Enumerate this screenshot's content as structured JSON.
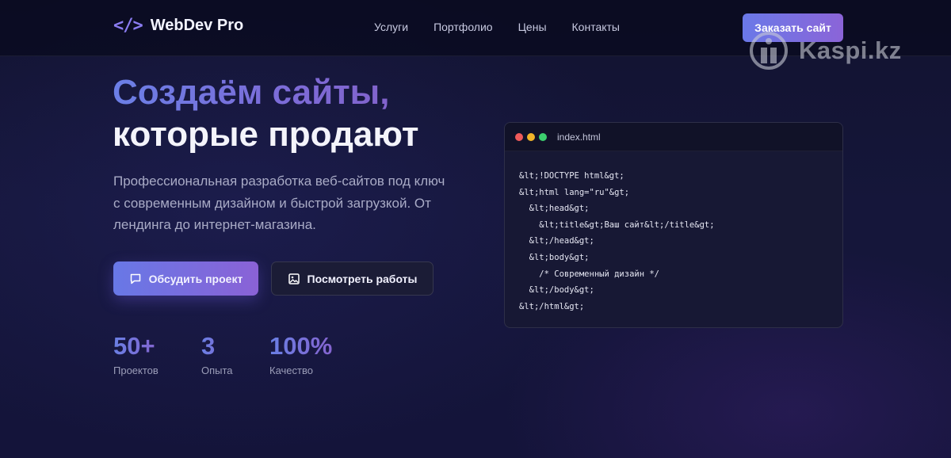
{
  "brand": {
    "logo_symbol": "</>",
    "name": "WebDev Pro"
  },
  "nav": {
    "items": [
      "Услуги",
      "Портфолио",
      "Цены",
      "Контакты"
    ]
  },
  "header": {
    "cta_label": "Заказать сайт"
  },
  "watermark": {
    "text": "Kaspi.kz"
  },
  "hero": {
    "title_line1": "Создаём сайты,",
    "title_line2": "которые продают",
    "description": "Профессиональная разработка веб-сайтов под ключ с современным дизайном и быстрой загрузкой. От лендинга до интернет-магазина.",
    "primary_button": {
      "label": "Обсудить проект",
      "icon": "chat-bubble-icon"
    },
    "secondary_button": {
      "label": "Посмотреть работы",
      "icon": "image-icon"
    }
  },
  "stats": [
    {
      "value": "50+",
      "label": "Проектов"
    },
    {
      "value": "3",
      "label": "Опыта"
    },
    {
      "value": "100%",
      "label": "Качество"
    }
  ],
  "code_window": {
    "filename": "index.html",
    "dots": [
      "#ef5a5a",
      "#f0b429",
      "#3ccf6e"
    ],
    "lines": [
      "&lt;!DOCTYPE html&gt;",
      "&lt;html lang=\"ru\"&gt;",
      "  &lt;head&gt;",
      "    &lt;title&gt;Ваш сайт&lt;/title&gt;",
      "  &lt;/head&gt;",
      "  &lt;body&gt;",
      "    /* Современный дизайн */",
      "  &lt;/body&gt;",
      "&lt;/html&gt;"
    ]
  },
  "colors": {
    "accent_start": "#6a79e8",
    "accent_end": "#8b64d8",
    "background": "#14143a"
  }
}
